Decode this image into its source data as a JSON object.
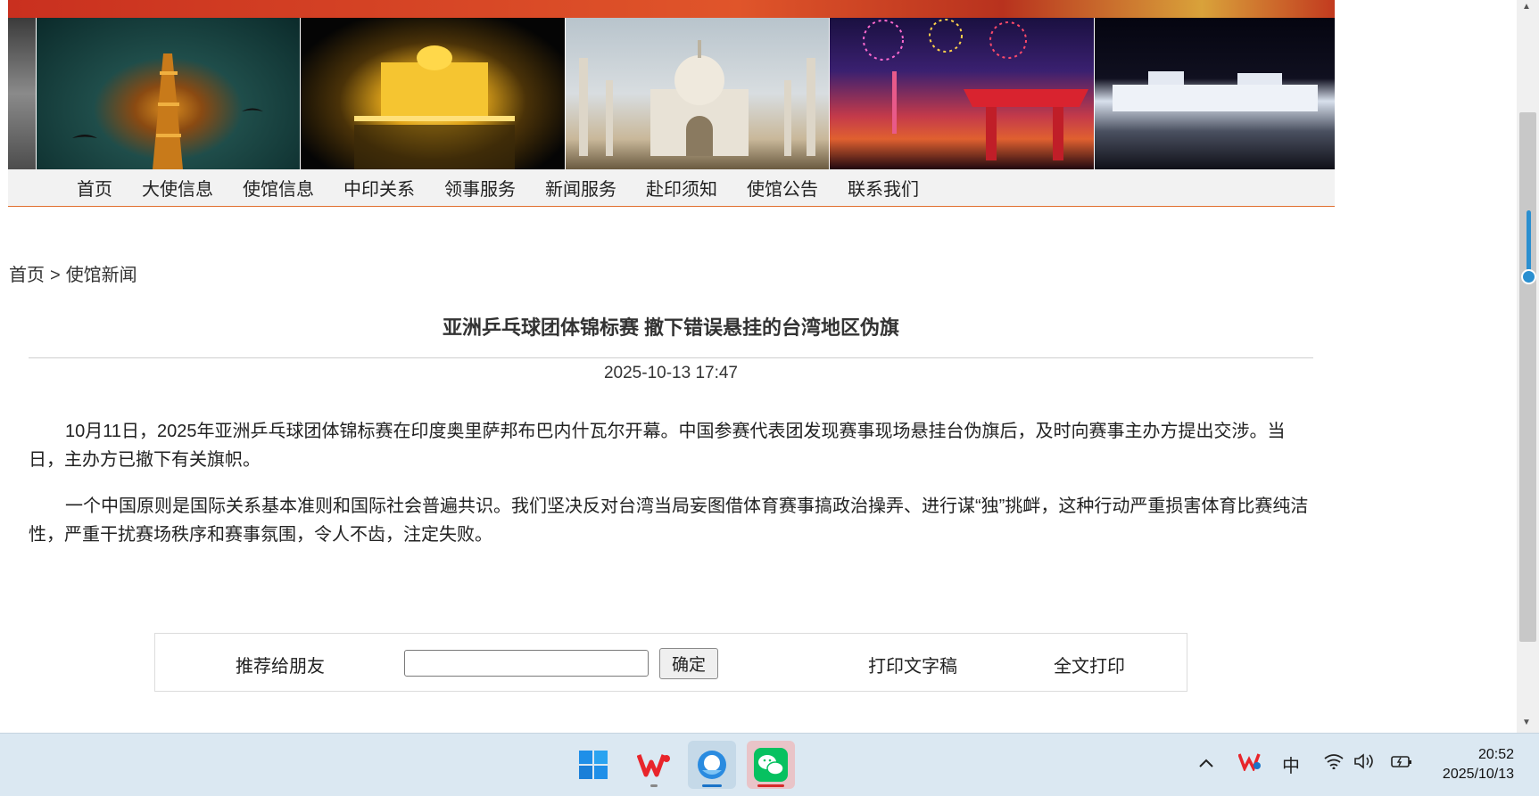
{
  "nav": {
    "items": [
      "首页",
      "大使信息",
      "使馆信息",
      "中印关系",
      "领事服务",
      "新闻服务",
      "赴印须知",
      "使馆公告",
      "联系我们"
    ]
  },
  "breadcrumb": {
    "home": "首页",
    "separator": ">",
    "current": "使馆新闻"
  },
  "article": {
    "title": "亚洲乒乓球团体锦标赛 撤下错误悬挂的台湾地区伪旗",
    "date": "2025-10-13 17:47",
    "paragraphs": [
      "10月11日，2025年亚洲乒乓球团体锦标赛在印度奥里萨邦布巴内什瓦尔开幕。中国参赛代表团发现赛事现场悬挂台伪旗后，及时向赛事主办方提出交涉。当日，主办方已撤下有关旗帜。",
      "一个中国原则是国际关系基本准则和国际社会普遍共识。我们坚决反对台湾当局妄图借体育赛事搞政治操弄、进行谋“独”挑衅，这种行动严重损害体育比赛纯洁性，严重干扰赛场秩序和赛事氛围，令人不齿，注定失败。"
    ]
  },
  "share": {
    "label": "推荐给朋友",
    "input_value": "",
    "confirm_label": "确定",
    "print_text_label": "打印文字稿",
    "print_full_label": "全文打印"
  },
  "taskbar": {
    "apps": [
      "windows-start-icon",
      "wps-office-icon",
      "browser-icon",
      "wechat-icon"
    ],
    "tray": {
      "ime": "中",
      "time": "20:52",
      "date": "2025/10/13"
    }
  },
  "colors": {
    "nav_border": "#e07030",
    "taskbar_bg": "#dbe8f2",
    "wechat_green": "#07c160",
    "start_blue": "#0078d4"
  }
}
